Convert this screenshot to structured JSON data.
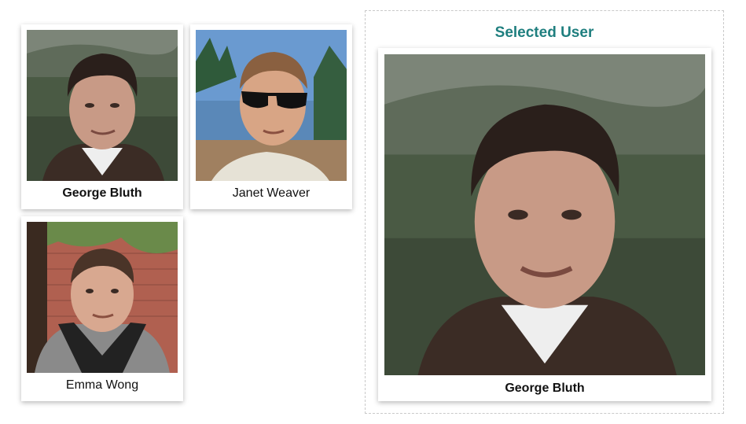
{
  "users": [
    {
      "name": "George Bluth",
      "selected": true
    },
    {
      "name": "Janet Weaver",
      "selected": false
    },
    {
      "name": "Emma Wong",
      "selected": false
    }
  ],
  "selected_panel": {
    "title": "Selected User",
    "user_name": "George Bluth"
  },
  "colors": {
    "accent": "#1f7f7f",
    "card_background": "#ffffff",
    "panel_border": "#c9c9c9"
  }
}
